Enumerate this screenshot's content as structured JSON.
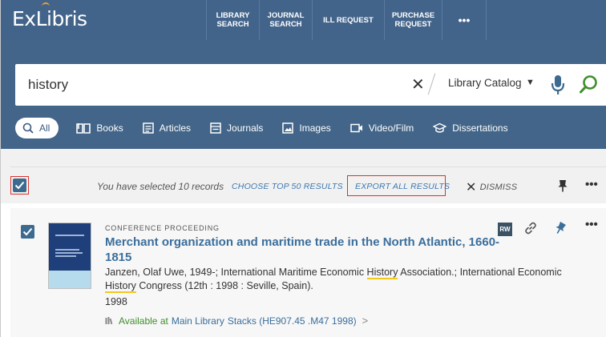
{
  "header": {
    "logo": {
      "part1": "Ex",
      "part2": "Libris"
    },
    "nav": [
      {
        "label": "LIBRARY\nSEARCH"
      },
      {
        "label": "JOURNAL\nSEARCH"
      },
      {
        "label": "ILL REQUEST"
      },
      {
        "label": "PURCHASE\nREQUEST"
      },
      {
        "label": "•••"
      }
    ]
  },
  "search": {
    "query": "history",
    "clear_icon": "close-icon",
    "scope": "Library Catalog",
    "mic_icon": "microphone-icon",
    "submit_icon": "search-icon"
  },
  "filters": [
    {
      "label": "All",
      "icon": "search-icon",
      "selected": true
    },
    {
      "label": "Books",
      "icon": "book-icon"
    },
    {
      "label": "Articles",
      "icon": "article-icon"
    },
    {
      "label": "Journals",
      "icon": "journal-icon"
    },
    {
      "label": "Images",
      "icon": "image-icon"
    },
    {
      "label": "Video/Film",
      "icon": "video-icon"
    },
    {
      "label": "Dissertations",
      "icon": "graduation-cap-icon"
    }
  ],
  "selection": {
    "message": "You have selected 10 records",
    "choose_top": "CHOOSE TOP 50 RESULTS",
    "export_all": "EXPORT ALL RESULTS",
    "dismiss": "DISMISS",
    "more": "•••",
    "colors": {
      "checkbox": "#3d6a8f",
      "highlight_box": "#d9332e"
    }
  },
  "record": {
    "type": "CONFERENCE PROCEEDING",
    "title": "Merchant organization and maritime trade in the North Atlantic, 1660-1815",
    "authors": {
      "p1": "Janzen, Olaf Uwe, 1949-; International Maritime Economic ",
      "hl1": "History",
      "p2": " Association.; International Economic ",
      "hl2": "History",
      "p3": " Congress (12th : 1998 : Seville, Spain)."
    },
    "year": "1998",
    "availability": {
      "status": "Available at",
      "location": "Main Library",
      "call_number": "Stacks (HE907.45 .M47 1998)",
      "chevron": ">"
    },
    "badge": "RW",
    "more": "•••"
  }
}
